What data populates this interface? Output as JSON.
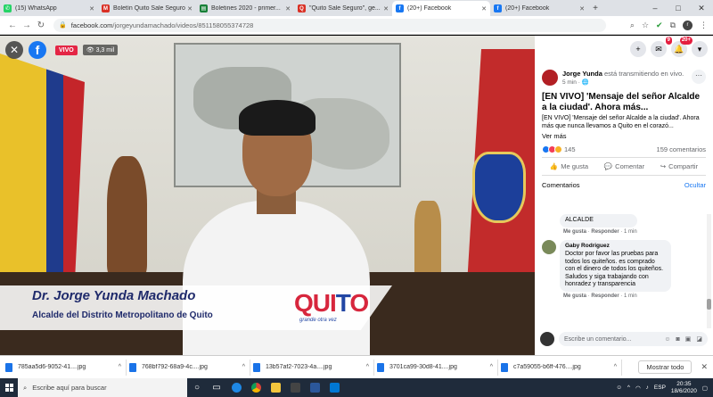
{
  "tabs": [
    {
      "title": "(15) WhatsApp",
      "color": "#25d366",
      "glyph": "✆"
    },
    {
      "title": "Boletín Quito Sale Seguro",
      "color": "#d93025",
      "glyph": "M"
    },
    {
      "title": "Boletines 2020 - primer...",
      "color": "#188038",
      "glyph": "▤"
    },
    {
      "title": "\"Quito Sale Seguro\", ge...",
      "color": "#d93025",
      "glyph": "Q"
    },
    {
      "title": "(20+) Facebook",
      "color": "#1877f2",
      "glyph": "f"
    },
    {
      "title": "(20+) Facebook",
      "color": "#1877f2",
      "glyph": "f"
    }
  ],
  "address": {
    "domain": "facebook.com",
    "path": "/jorgeyundamachado/videos/851158055374728"
  },
  "video": {
    "live_label": "VIVO",
    "views": "3,3 mil",
    "name": "Dr. Jorge Yunda Machado",
    "role": "Alcalde del Distrito Metropolitano de Quito",
    "logo_text": "QUITO",
    "logo_sub": "grande otra vez"
  },
  "fb_top": {
    "messenger_badge": "9",
    "notif_badge": "20+"
  },
  "post": {
    "author": "Jorge Yunda",
    "status": "está transmitiendo en vivo.",
    "time": "5 min · ",
    "title": "[EN VIVO] 'Mensaje del señor Alcalde a la ciudad'. Ahora más...",
    "body": "[EN VIVO] 'Mensaje del señor Alcalde a la ciudad'. Ahora más que nunca llevamos a Quito en el corazó...",
    "see_more": "Ver más",
    "reactions": "145",
    "comments_count": "159 comentarios",
    "like": "Me gusta",
    "comment": "Comentar",
    "share": "Compartir"
  },
  "comments_header": {
    "label": "Comentarios",
    "hide": "Ocultar"
  },
  "comments": [
    {
      "author": "",
      "text": "ALCALDE",
      "like": "Me gusta",
      "reply": "Responder",
      "time": "1 min"
    },
    {
      "author": "Gaby Rodriguez",
      "text": "Doctor por favor las pruebas para todos los quiteños. es comprado con el dinero de todos los quiteños. Saludos y siga trabajando con honradez y transparencia",
      "like": "Me gusta",
      "reply": "Responder",
      "time": "1 min"
    }
  ],
  "comment_box": {
    "placeholder": "Escribe un comentario..."
  },
  "downloads": [
    "785aa5d6-9052-41....jpg",
    "768bf792-68a9-4c....jpg",
    "13b57af2-7023-4a....jpg",
    "3701ca99-30d8-41....jpg",
    "c7a59055-b6ff-476....jpg"
  ],
  "show_all": "Mostrar todo",
  "taskbar": {
    "search": "Escribe aquí para buscar",
    "lang": "ESP",
    "time": "20:35",
    "date": "18/6/2020"
  }
}
